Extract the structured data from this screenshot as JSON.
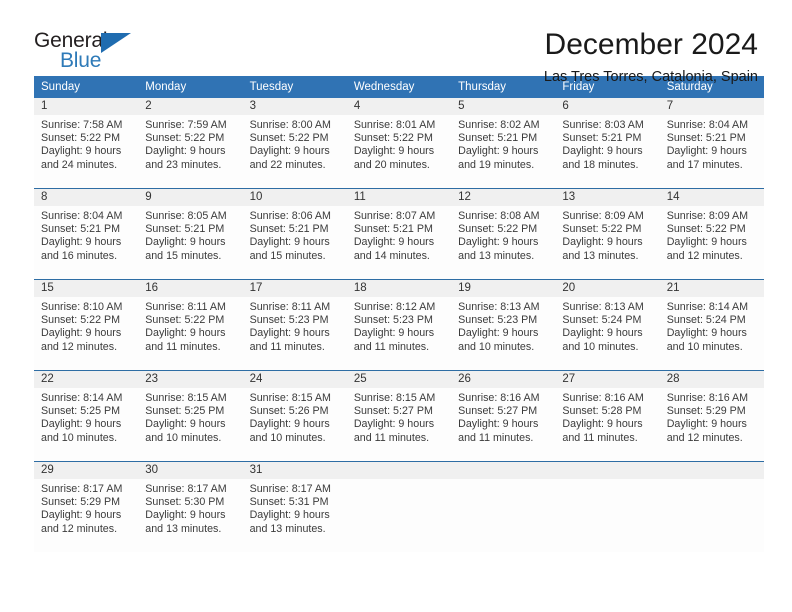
{
  "brand": {
    "name_top": "General",
    "name_bottom": "Blue",
    "triangle_color": "#1f6cb0",
    "blue_text_color": "#2e7ab8"
  },
  "header": {
    "month_title": "December 2024",
    "location": "Las Tres Torres, Catalonia, Spain"
  },
  "theme": {
    "header_blue": "#3073b4",
    "row_divider": "#2e6da4",
    "daynum_band": "#f0f0f0"
  },
  "calendar": {
    "weekday_headers": [
      "Sunday",
      "Monday",
      "Tuesday",
      "Wednesday",
      "Thursday",
      "Friday",
      "Saturday"
    ],
    "weeks": [
      [
        {
          "day": "1",
          "sunrise": "Sunrise: 7:58 AM",
          "sunset": "Sunset: 5:22 PM",
          "daylight_line1": "Daylight: 9 hours",
          "daylight_line2": "and 24 minutes."
        },
        {
          "day": "2",
          "sunrise": "Sunrise: 7:59 AM",
          "sunset": "Sunset: 5:22 PM",
          "daylight_line1": "Daylight: 9 hours",
          "daylight_line2": "and 23 minutes."
        },
        {
          "day": "3",
          "sunrise": "Sunrise: 8:00 AM",
          "sunset": "Sunset: 5:22 PM",
          "daylight_line1": "Daylight: 9 hours",
          "daylight_line2": "and 22 minutes."
        },
        {
          "day": "4",
          "sunrise": "Sunrise: 8:01 AM",
          "sunset": "Sunset: 5:22 PM",
          "daylight_line1": "Daylight: 9 hours",
          "daylight_line2": "and 20 minutes."
        },
        {
          "day": "5",
          "sunrise": "Sunrise: 8:02 AM",
          "sunset": "Sunset: 5:21 PM",
          "daylight_line1": "Daylight: 9 hours",
          "daylight_line2": "and 19 minutes."
        },
        {
          "day": "6",
          "sunrise": "Sunrise: 8:03 AM",
          "sunset": "Sunset: 5:21 PM",
          "daylight_line1": "Daylight: 9 hours",
          "daylight_line2": "and 18 minutes."
        },
        {
          "day": "7",
          "sunrise": "Sunrise: 8:04 AM",
          "sunset": "Sunset: 5:21 PM",
          "daylight_line1": "Daylight: 9 hours",
          "daylight_line2": "and 17 minutes."
        }
      ],
      [
        {
          "day": "8",
          "sunrise": "Sunrise: 8:04 AM",
          "sunset": "Sunset: 5:21 PM",
          "daylight_line1": "Daylight: 9 hours",
          "daylight_line2": "and 16 minutes."
        },
        {
          "day": "9",
          "sunrise": "Sunrise: 8:05 AM",
          "sunset": "Sunset: 5:21 PM",
          "daylight_line1": "Daylight: 9 hours",
          "daylight_line2": "and 15 minutes."
        },
        {
          "day": "10",
          "sunrise": "Sunrise: 8:06 AM",
          "sunset": "Sunset: 5:21 PM",
          "daylight_line1": "Daylight: 9 hours",
          "daylight_line2": "and 15 minutes."
        },
        {
          "day": "11",
          "sunrise": "Sunrise: 8:07 AM",
          "sunset": "Sunset: 5:21 PM",
          "daylight_line1": "Daylight: 9 hours",
          "daylight_line2": "and 14 minutes."
        },
        {
          "day": "12",
          "sunrise": "Sunrise: 8:08 AM",
          "sunset": "Sunset: 5:22 PM",
          "daylight_line1": "Daylight: 9 hours",
          "daylight_line2": "and 13 minutes."
        },
        {
          "day": "13",
          "sunrise": "Sunrise: 8:09 AM",
          "sunset": "Sunset: 5:22 PM",
          "daylight_line1": "Daylight: 9 hours",
          "daylight_line2": "and 13 minutes."
        },
        {
          "day": "14",
          "sunrise": "Sunrise: 8:09 AM",
          "sunset": "Sunset: 5:22 PM",
          "daylight_line1": "Daylight: 9 hours",
          "daylight_line2": "and 12 minutes."
        }
      ],
      [
        {
          "day": "15",
          "sunrise": "Sunrise: 8:10 AM",
          "sunset": "Sunset: 5:22 PM",
          "daylight_line1": "Daylight: 9 hours",
          "daylight_line2": "and 12 minutes."
        },
        {
          "day": "16",
          "sunrise": "Sunrise: 8:11 AM",
          "sunset": "Sunset: 5:22 PM",
          "daylight_line1": "Daylight: 9 hours",
          "daylight_line2": "and 11 minutes."
        },
        {
          "day": "17",
          "sunrise": "Sunrise: 8:11 AM",
          "sunset": "Sunset: 5:23 PM",
          "daylight_line1": "Daylight: 9 hours",
          "daylight_line2": "and 11 minutes."
        },
        {
          "day": "18",
          "sunrise": "Sunrise: 8:12 AM",
          "sunset": "Sunset: 5:23 PM",
          "daylight_line1": "Daylight: 9 hours",
          "daylight_line2": "and 11 minutes."
        },
        {
          "day": "19",
          "sunrise": "Sunrise: 8:13 AM",
          "sunset": "Sunset: 5:23 PM",
          "daylight_line1": "Daylight: 9 hours",
          "daylight_line2": "and 10 minutes."
        },
        {
          "day": "20",
          "sunrise": "Sunrise: 8:13 AM",
          "sunset": "Sunset: 5:24 PM",
          "daylight_line1": "Daylight: 9 hours",
          "daylight_line2": "and 10 minutes."
        },
        {
          "day": "21",
          "sunrise": "Sunrise: 8:14 AM",
          "sunset": "Sunset: 5:24 PM",
          "daylight_line1": "Daylight: 9 hours",
          "daylight_line2": "and 10 minutes."
        }
      ],
      [
        {
          "day": "22",
          "sunrise": "Sunrise: 8:14 AM",
          "sunset": "Sunset: 5:25 PM",
          "daylight_line1": "Daylight: 9 hours",
          "daylight_line2": "and 10 minutes."
        },
        {
          "day": "23",
          "sunrise": "Sunrise: 8:15 AM",
          "sunset": "Sunset: 5:25 PM",
          "daylight_line1": "Daylight: 9 hours",
          "daylight_line2": "and 10 minutes."
        },
        {
          "day": "24",
          "sunrise": "Sunrise: 8:15 AM",
          "sunset": "Sunset: 5:26 PM",
          "daylight_line1": "Daylight: 9 hours",
          "daylight_line2": "and 10 minutes."
        },
        {
          "day": "25",
          "sunrise": "Sunrise: 8:15 AM",
          "sunset": "Sunset: 5:27 PM",
          "daylight_line1": "Daylight: 9 hours",
          "daylight_line2": "and 11 minutes."
        },
        {
          "day": "26",
          "sunrise": "Sunrise: 8:16 AM",
          "sunset": "Sunset: 5:27 PM",
          "daylight_line1": "Daylight: 9 hours",
          "daylight_line2": "and 11 minutes."
        },
        {
          "day": "27",
          "sunrise": "Sunrise: 8:16 AM",
          "sunset": "Sunset: 5:28 PM",
          "daylight_line1": "Daylight: 9 hours",
          "daylight_line2": "and 11 minutes."
        },
        {
          "day": "28",
          "sunrise": "Sunrise: 8:16 AM",
          "sunset": "Sunset: 5:29 PM",
          "daylight_line1": "Daylight: 9 hours",
          "daylight_line2": "and 12 minutes."
        }
      ],
      [
        {
          "day": "29",
          "sunrise": "Sunrise: 8:17 AM",
          "sunset": "Sunset: 5:29 PM",
          "daylight_line1": "Daylight: 9 hours",
          "daylight_line2": "and 12 minutes."
        },
        {
          "day": "30",
          "sunrise": "Sunrise: 8:17 AM",
          "sunset": "Sunset: 5:30 PM",
          "daylight_line1": "Daylight: 9 hours",
          "daylight_line2": "and 13 minutes."
        },
        {
          "day": "31",
          "sunrise": "Sunrise: 8:17 AM",
          "sunset": "Sunset: 5:31 PM",
          "daylight_line1": "Daylight: 9 hours",
          "daylight_line2": "and 13 minutes."
        },
        {
          "day": "",
          "sunrise": "",
          "sunset": "",
          "daylight_line1": "",
          "daylight_line2": ""
        },
        {
          "day": "",
          "sunrise": "",
          "sunset": "",
          "daylight_line1": "",
          "daylight_line2": ""
        },
        {
          "day": "",
          "sunrise": "",
          "sunset": "",
          "daylight_line1": "",
          "daylight_line2": ""
        },
        {
          "day": "",
          "sunrise": "",
          "sunset": "",
          "daylight_line1": "",
          "daylight_line2": ""
        }
      ]
    ]
  }
}
